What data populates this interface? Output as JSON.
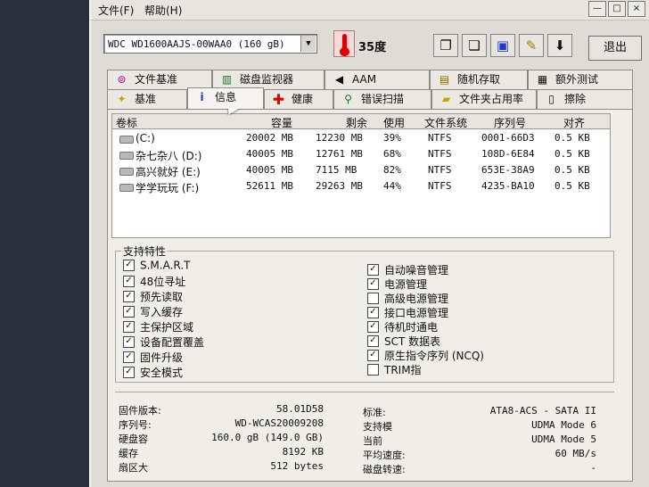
{
  "menu": {
    "file": "文件(F)",
    "help": "帮助(H)"
  },
  "window_buttons": {
    "minimize": "—",
    "maximize": "□",
    "close": "×"
  },
  "toolbar": {
    "drive_select": "WDC WD1600AAJS-00WAA0 (160 gB)",
    "temperature": "35度",
    "exit_label": "退出"
  },
  "tabs_row1": [
    "文件基准",
    "磁盘监视器",
    "AAM",
    "随机存取",
    "额外测试"
  ],
  "tabs_row2": [
    "基准",
    "信息",
    "健康",
    "错误扫描",
    "文件夹占用率",
    "擦除"
  ],
  "volumes": {
    "headers": [
      "卷标",
      "容量",
      "剩余",
      "使用",
      "文件系统",
      "序列号",
      "对齐"
    ],
    "rows": [
      {
        "label": "(C:)",
        "capacity": "20002 MB",
        "free": "12230 MB",
        "used": "39%",
        "fs": "NTFS",
        "serial": "0001-66D3",
        "align": "0.5 KB"
      },
      {
        "label": "杂七杂八 (D:)",
        "capacity": "40005 MB",
        "free": "12761 MB",
        "used": "68%",
        "fs": "NTFS",
        "serial": "108D-6E84",
        "align": "0.5 KB"
      },
      {
        "label": "高兴就好 (E:)",
        "capacity": "40005 MB",
        "free": "7115 MB",
        "used": "82%",
        "fs": "NTFS",
        "serial": "653E-38A9",
        "align": "0.5 KB"
      },
      {
        "label": "学学玩玩 (F:)",
        "capacity": "52611 MB",
        "free": "29263 MB",
        "used": "44%",
        "fs": "NTFS",
        "serial": "4235-BA10",
        "align": "0.5 KB"
      }
    ]
  },
  "features": {
    "title": "支持特性",
    "left": [
      {
        "label": "S.M.A.R.T",
        "checked": true
      },
      {
        "label": "48位寻址",
        "checked": true
      },
      {
        "label": "预先读取",
        "checked": true
      },
      {
        "label": "写入缓存",
        "checked": true
      },
      {
        "label": "主保护区域",
        "checked": true
      },
      {
        "label": "设备配置覆盖",
        "checked": true
      },
      {
        "label": "固件升级",
        "checked": true
      },
      {
        "label": "安全模式",
        "checked": true
      }
    ],
    "right": [
      {
        "label": "自动噪音管理",
        "checked": true
      },
      {
        "label": "电源管理",
        "checked": true
      },
      {
        "label": "高级电源管理",
        "checked": false
      },
      {
        "label": "接口电源管理",
        "checked": true
      },
      {
        "label": "待机时通电",
        "checked": true
      },
      {
        "label": "SCT 数据表",
        "checked": true
      },
      {
        "label": "原生指令序列 (NCQ)",
        "checked": true
      },
      {
        "label": "TRIM指",
        "checked": false
      }
    ]
  },
  "info_left": [
    {
      "label": "固件版本:",
      "value": "58.01D58"
    },
    {
      "label": "序列号:",
      "value": "WD-WCAS20009208"
    },
    {
      "label": "硬盘容",
      "value": "160.0 gB (149.0 GB)"
    },
    {
      "label": "缓存",
      "value": "8192 KB"
    },
    {
      "label": "扇区大",
      "value": "512 bytes"
    }
  ],
  "info_right": [
    {
      "label": "标准:",
      "value": "ATA8-ACS - SATA II"
    },
    {
      "label": "支持模",
      "value": "UDMA Mode 6"
    },
    {
      "label": "当前",
      "value": "UDMA Mode 5"
    },
    {
      "label": "平均速度:",
      "value": "60 MB/s"
    },
    {
      "label": "磁盘转速:",
      "value": "-"
    }
  ]
}
